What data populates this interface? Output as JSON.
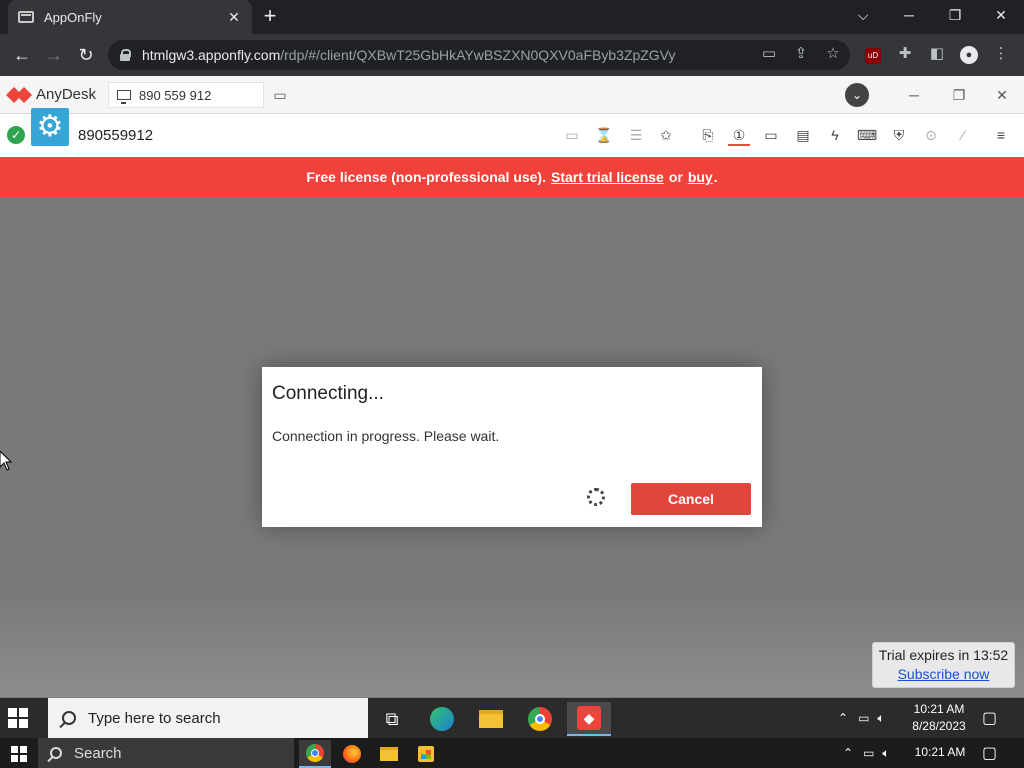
{
  "browser": {
    "tab_title": "AppOnFly",
    "tab_close": "✕",
    "new_tab": "+",
    "url_host": "htmlgw3.apponfly.com",
    "url_path": "/rdp/#/client/QXBwT25GbHkAYwBSZXN0QXV0aFByb3ZpZGVy"
  },
  "anydesk": {
    "app_name": "AnyDesk",
    "desk_id": "890 559 912",
    "session_id": "890559912"
  },
  "banner": {
    "text_prefix": "Free license (non-professional use).",
    "trial_link": "Start trial license",
    "or": "or",
    "buy_link": "buy",
    "dot": "."
  },
  "dialog": {
    "title": "Connecting...",
    "message": "Connection in progress. Please wait.",
    "cancel_label": "Cancel"
  },
  "trial": {
    "expires": "Trial expires in 13:52",
    "subscribe": "Subscribe now"
  },
  "remote_taskbar": {
    "search_placeholder": "Type here to search",
    "time": "10:21 AM",
    "date": "8/28/2023"
  },
  "local_taskbar": {
    "search_label": "Search",
    "time": "10:21 AM"
  },
  "colors": {
    "banner": "#f0413a",
    "cancel_button": "#e2453c",
    "anydesk_red": "#ef443b",
    "gear_blue": "#37a6d6"
  }
}
